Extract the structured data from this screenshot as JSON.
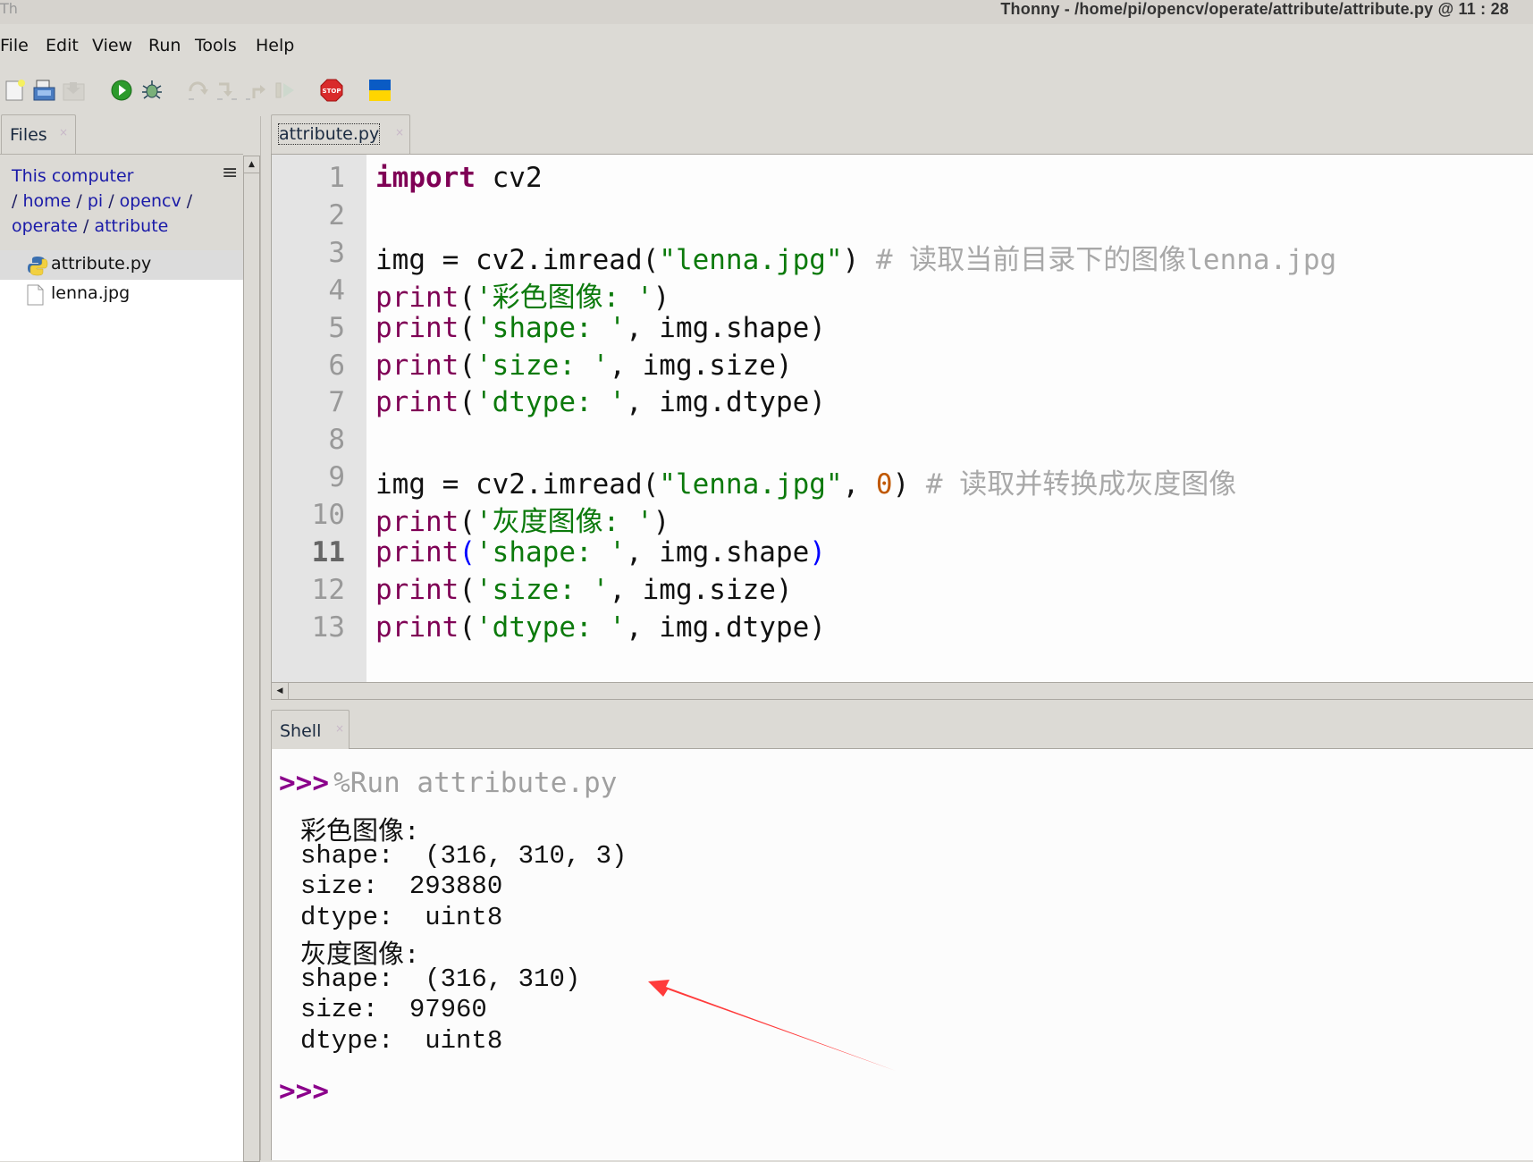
{
  "window": {
    "title": "Thonny  -  /home/pi/opencv/operate/attribute/attribute.py  @  11 : 28"
  },
  "menu": [
    "File",
    "Edit",
    "View",
    "Run",
    "Tools",
    "Help"
  ],
  "toolbar": {
    "buttons": [
      {
        "name": "new-file",
        "icon": "new-file-icon",
        "enabled": true
      },
      {
        "name": "save",
        "icon": "save-icon",
        "enabled": true
      },
      {
        "name": "load",
        "icon": "load-icon",
        "enabled": false
      },
      {
        "name": "run",
        "icon": "run-icon",
        "enabled": true
      },
      {
        "name": "debug",
        "icon": "debug-bug-icon",
        "enabled": true
      },
      {
        "name": "step-over",
        "icon": "step-over-icon",
        "enabled": false
      },
      {
        "name": "step-into",
        "icon": "step-into-icon",
        "enabled": false
      },
      {
        "name": "step-out",
        "icon": "step-out-icon",
        "enabled": false
      },
      {
        "name": "resume",
        "icon": "resume-icon",
        "enabled": false
      },
      {
        "name": "stop",
        "icon": "stop-icon",
        "label": "STOP",
        "enabled": true
      },
      {
        "name": "ukraine-flag",
        "icon": "flag-icon",
        "enabled": true
      }
    ]
  },
  "files_panel": {
    "tab_label": "Files",
    "breadcrumb": {
      "root": "This computer",
      "parts": [
        "home",
        "pi",
        "opencv",
        "operate",
        "attribute"
      ]
    },
    "files": [
      {
        "name": "attribute.py",
        "type": "python",
        "selected": true
      },
      {
        "name": "lenna.jpg",
        "type": "file",
        "selected": false
      }
    ]
  },
  "editor": {
    "tab_label": "attribute.py",
    "current_line": 11,
    "lines": [
      {
        "n": "1",
        "tokens": [
          {
            "t": "import",
            "c": "kw"
          },
          {
            "t": " cv2",
            "c": ""
          }
        ]
      },
      {
        "n": "2",
        "tokens": []
      },
      {
        "n": "3",
        "tokens": [
          {
            "t": "img = cv2.imread(",
            "c": ""
          },
          {
            "t": "\"lenna.jpg\"",
            "c": "str"
          },
          {
            "t": ") ",
            "c": ""
          },
          {
            "t": "# 读取当前目录下的图像lenna.jpg",
            "c": "cm"
          }
        ]
      },
      {
        "n": "4",
        "tokens": [
          {
            "t": "print",
            "c": "fn"
          },
          {
            "t": "(",
            "c": ""
          },
          {
            "t": "'彩色图像: '",
            "c": "str"
          },
          {
            "t": ")",
            "c": ""
          }
        ]
      },
      {
        "n": "5",
        "tokens": [
          {
            "t": "print",
            "c": "fn"
          },
          {
            "t": "(",
            "c": ""
          },
          {
            "t": "'shape: '",
            "c": "str"
          },
          {
            "t": ", img.shape)",
            "c": ""
          }
        ]
      },
      {
        "n": "6",
        "tokens": [
          {
            "t": "print",
            "c": "fn"
          },
          {
            "t": "(",
            "c": ""
          },
          {
            "t": "'size: '",
            "c": "str"
          },
          {
            "t": ", img.size)",
            "c": ""
          }
        ]
      },
      {
        "n": "7",
        "tokens": [
          {
            "t": "print",
            "c": "fn"
          },
          {
            "t": "(",
            "c": ""
          },
          {
            "t": "'dtype: '",
            "c": "str"
          },
          {
            "t": ", img.dtype)",
            "c": ""
          }
        ]
      },
      {
        "n": "8",
        "tokens": []
      },
      {
        "n": "9",
        "tokens": [
          {
            "t": "img = cv2.imread(",
            "c": ""
          },
          {
            "t": "\"lenna.jpg\"",
            "c": "str"
          },
          {
            "t": ", ",
            "c": ""
          },
          {
            "t": "0",
            "c": "num"
          },
          {
            "t": ") ",
            "c": ""
          },
          {
            "t": "# 读取并转换成灰度图像",
            "c": "cm"
          }
        ]
      },
      {
        "n": "10",
        "tokens": [
          {
            "t": "print",
            "c": "fn"
          },
          {
            "t": "(",
            "c": ""
          },
          {
            "t": "'灰度图像: '",
            "c": "str"
          },
          {
            "t": ")",
            "c": ""
          }
        ]
      },
      {
        "n": "11",
        "tokens": [
          {
            "t": "print",
            "c": "fn"
          },
          {
            "t": "(",
            "c": "br"
          },
          {
            "t": "'shape: '",
            "c": "str"
          },
          {
            "t": ", img.shape",
            "c": ""
          },
          {
            "t": ")",
            "c": "br"
          }
        ]
      },
      {
        "n": "12",
        "tokens": [
          {
            "t": "print",
            "c": "fn"
          },
          {
            "t": "(",
            "c": ""
          },
          {
            "t": "'size: '",
            "c": "str"
          },
          {
            "t": ", img.size)",
            "c": ""
          }
        ]
      },
      {
        "n": "13",
        "tokens": [
          {
            "t": "print",
            "c": "fn"
          },
          {
            "t": "(",
            "c": ""
          },
          {
            "t": "'dtype: '",
            "c": "str"
          },
          {
            "t": ", img.dtype)",
            "c": ""
          }
        ]
      }
    ]
  },
  "shell": {
    "tab_label": "Shell",
    "prompt": ">>>",
    "command": "%Run attribute.py",
    "output": [
      "彩色图像:",
      "shape:  (316, 310, 3)",
      "size:  293880",
      "dtype:  uint8",
      "灰度图像:",
      "shape:  (316, 310)",
      "size:  97960",
      "dtype:  uint8"
    ],
    "final_prompt": ">>>"
  },
  "annotation": {
    "type": "arrow",
    "color": "#ff3b3b",
    "points_to": "shape:  (316, 310)"
  },
  "colors": {
    "keyword": "#7f0055",
    "string": "#0c7a0c",
    "comment": "#a8a8a8",
    "number": "#c05800",
    "prompt": "#8b008b",
    "link": "#1a1aa8"
  }
}
